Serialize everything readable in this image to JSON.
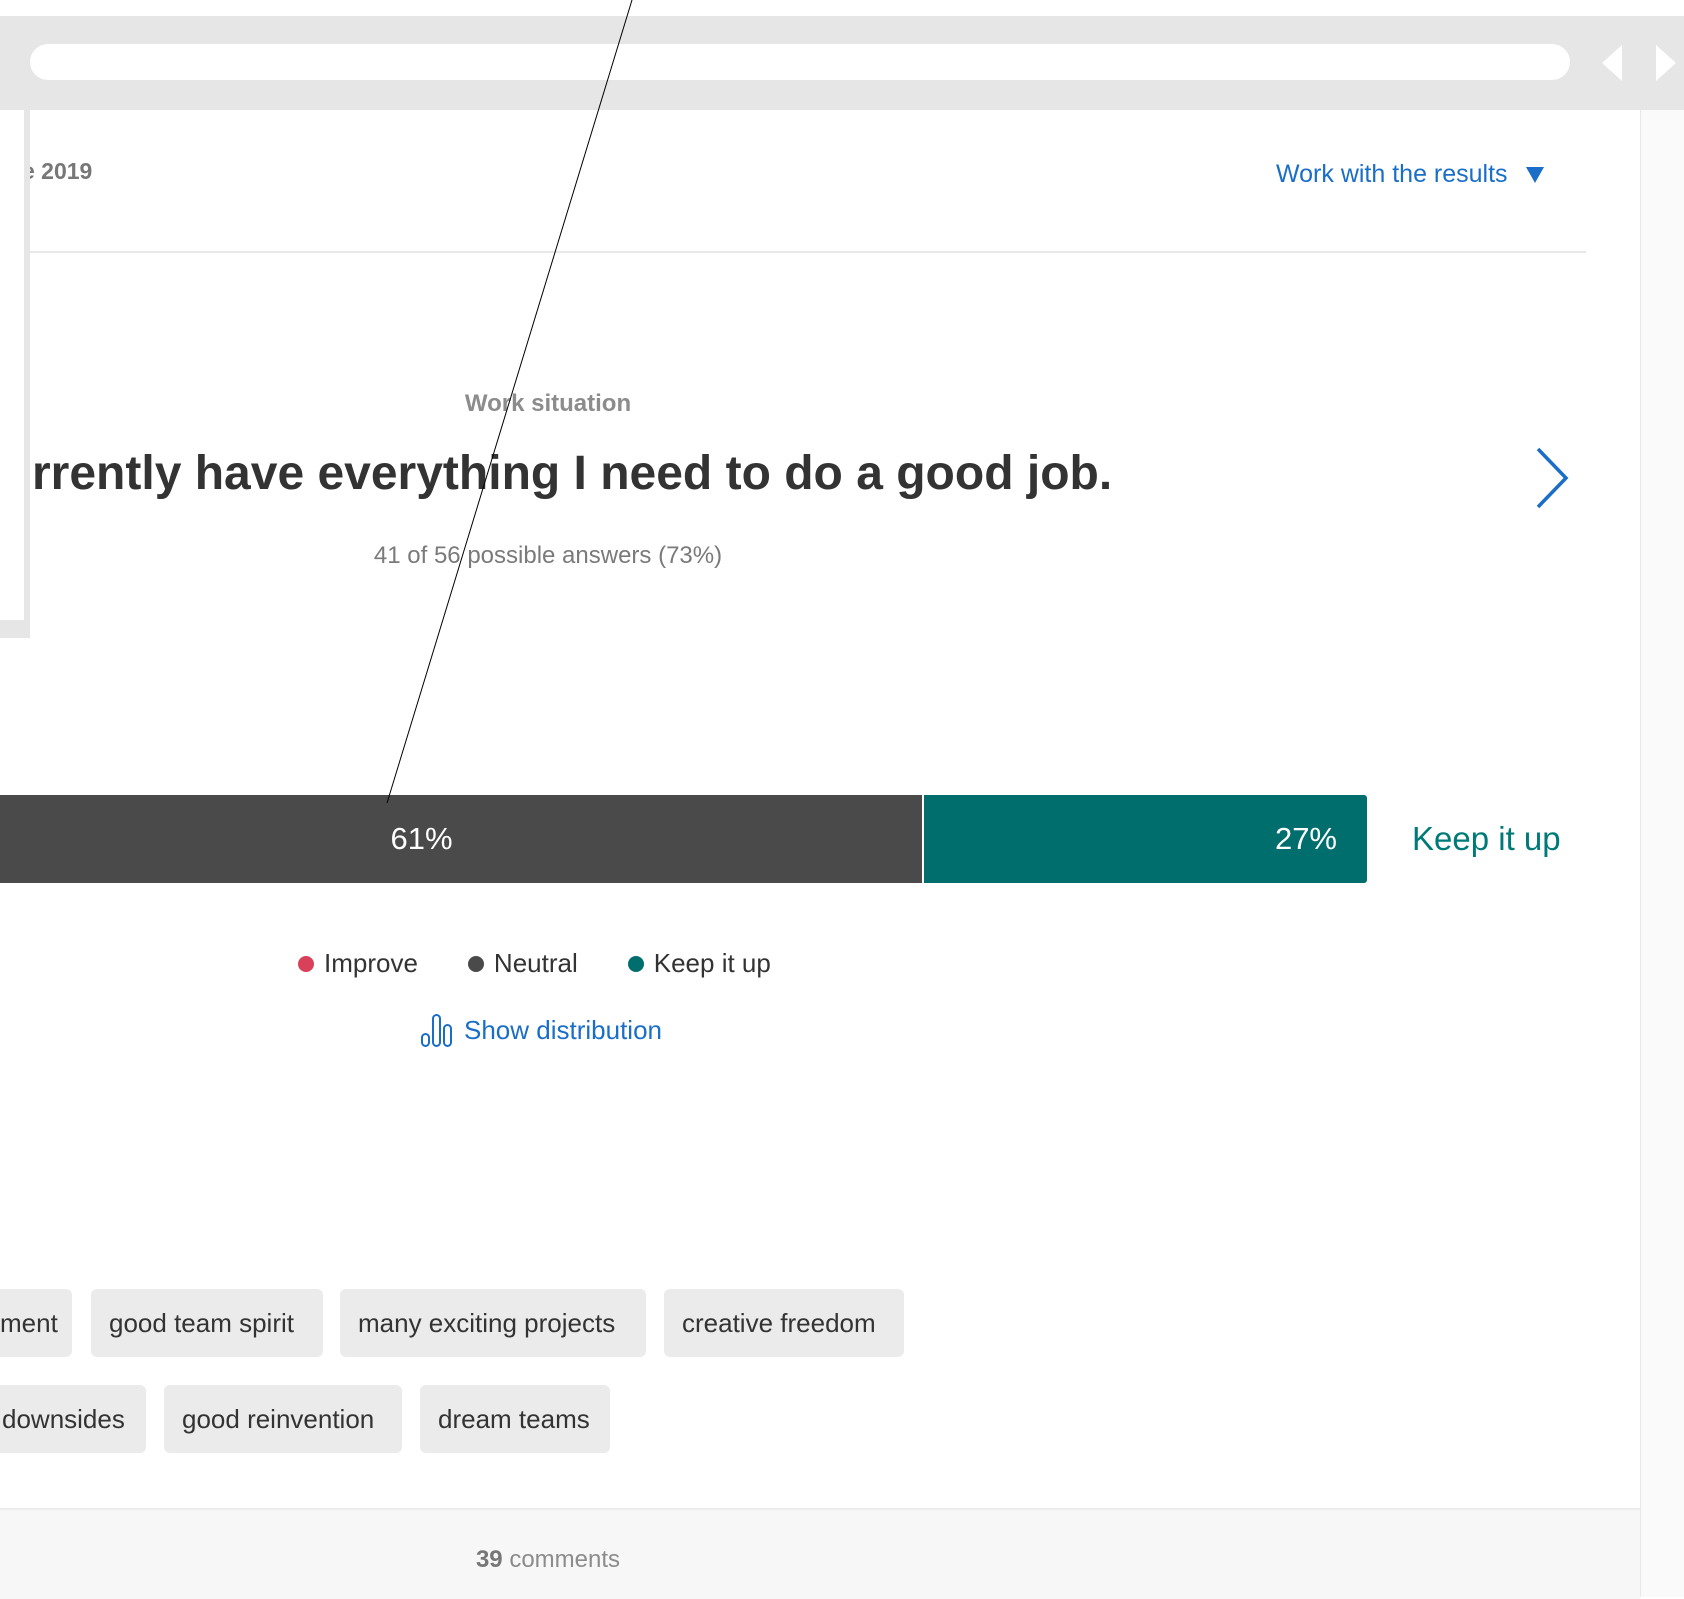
{
  "header": {
    "date_text": "e 2019",
    "work_with_results": "Work with the results"
  },
  "question": {
    "category": "Work situation",
    "text": "rrently have everything I need to do a good job.",
    "answers": "41 of 56 possible answers (73%)"
  },
  "result_bar": {
    "neutral_label": "61%",
    "neutral_value": 61,
    "keep_label": "27%",
    "keep_value": 27,
    "outcome_label": "Keep it up",
    "colors": {
      "improve": "#d9415a",
      "neutral": "#4a4a4a",
      "keep": "#006e6d"
    }
  },
  "legend": {
    "improve": "Improve",
    "neutral": "Neutral",
    "keep": "Keep it up"
  },
  "show_distribution": "Show distribution",
  "tags": {
    "row1": [
      "ment",
      "good team spirit",
      "many exciting projects",
      "creative freedom"
    ],
    "row2": [
      "downsides",
      "good reinvention",
      "dream teams"
    ]
  },
  "comments": {
    "count": "39",
    "label": "comments"
  },
  "icons": {
    "dropdown": "triangle-down-icon",
    "next": "chevron-right-icon",
    "distribution": "bar-chart-icon",
    "back": "triangle-left-icon",
    "forward": "triangle-right-icon"
  }
}
